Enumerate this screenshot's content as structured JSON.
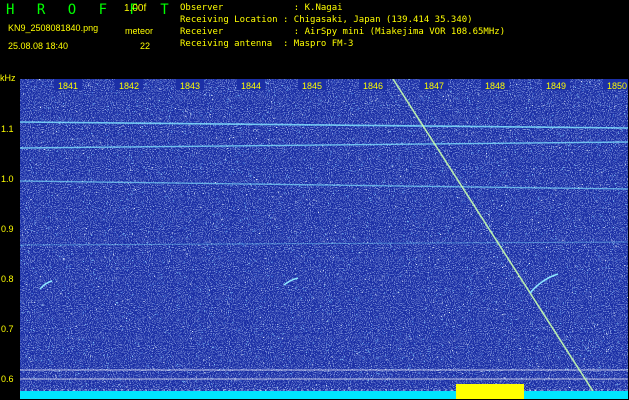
{
  "header": {
    "logo": "H R O F F T",
    "version": "1.00f",
    "filename": "KN9_2508081840.png",
    "datetime": "25.08.08 18:40",
    "meteor_label": "meteor",
    "meteor_count": "22",
    "observer": "Observer             : K.Nagai",
    "location": "Receiving Location : Chigasaki, Japan (139.414 35.340)",
    "receiver": "Receiver             : AirSpy mini (Miakejima VOR 108.65MHz)",
    "antenna": "Receiving antenna  : Maspro FM-3"
  },
  "axis": {
    "y_unit": "kHz",
    "y_ticks": [
      "1.1",
      "1.0",
      "0.9",
      "0.8",
      "0.7",
      "0.6"
    ],
    "x_ticks": [
      "1841",
      "1842",
      "1843",
      "1844",
      "1845",
      "1846",
      "1847",
      "1848",
      "1849",
      "1850"
    ]
  },
  "colors": {
    "background": "#1a2ea8",
    "header_text": "#ffff00",
    "logo": "#00ff00",
    "cyan": "#00e5ff",
    "yellow_bar": "#ffff00"
  }
}
